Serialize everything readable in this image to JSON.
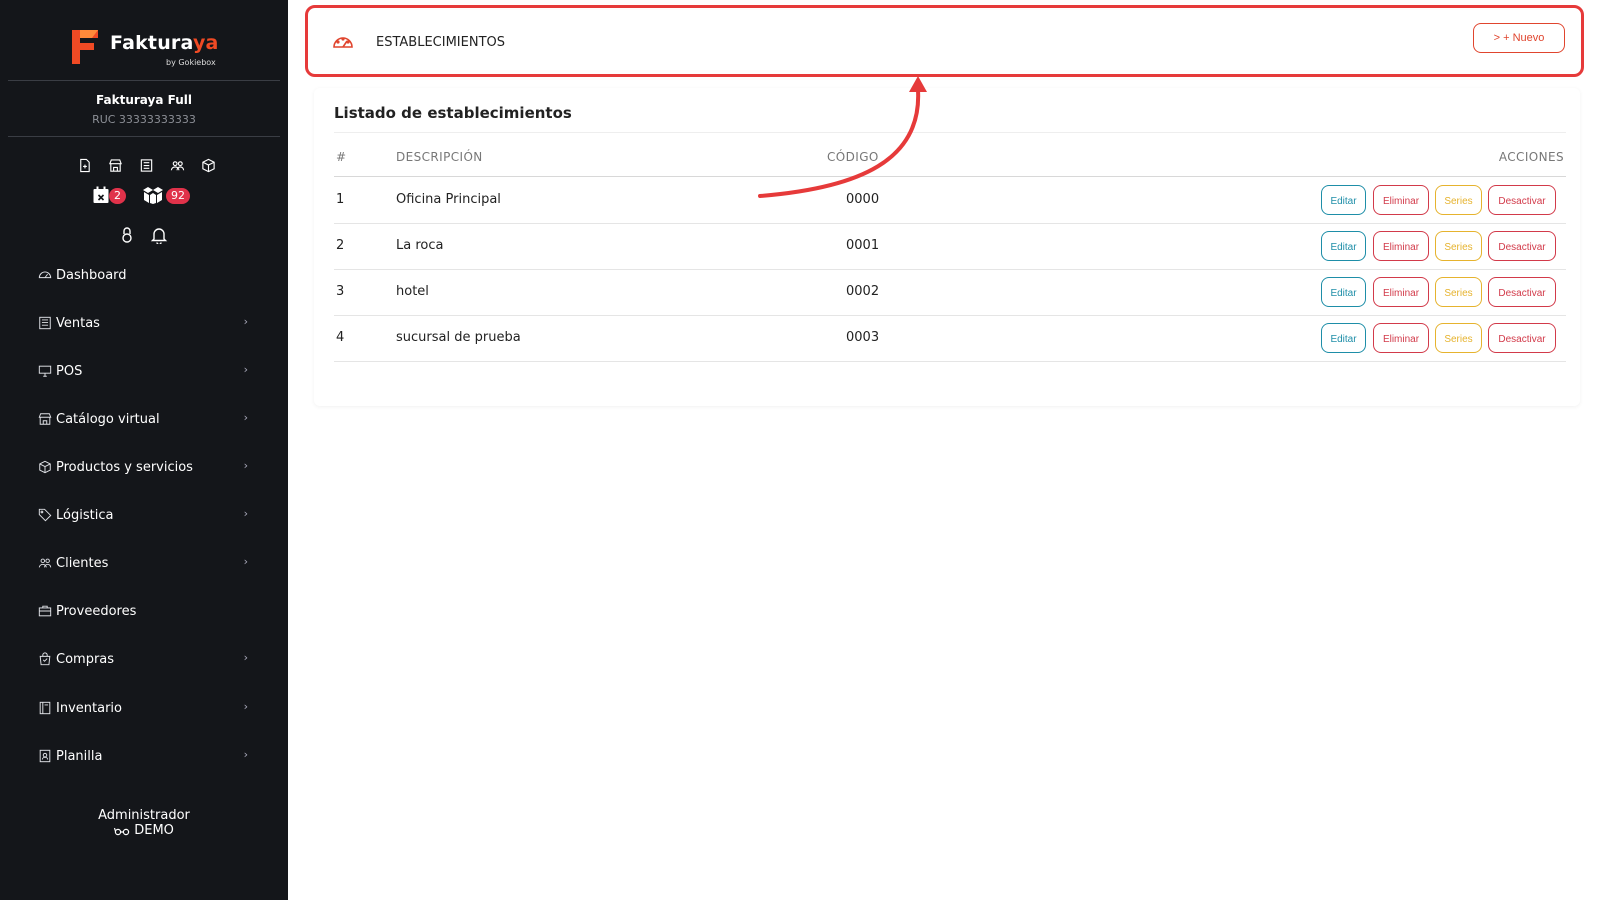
{
  "brand": {
    "name_main": "Faktura",
    "name_accent": "ya",
    "byline": "by Gokiebox",
    "accent_color": "#f04a24",
    "sidebar_bg": "#14161a"
  },
  "company": {
    "name": "Fakturaya Full",
    "ruc": "RUC 33333333333"
  },
  "quick_icons": [
    "document-plus-icon",
    "store-icon",
    "receipt-icon",
    "users-icon",
    "box-icon"
  ],
  "badges": {
    "calendar_count": "2",
    "boxes_count": "92"
  },
  "nav": [
    {
      "label": "Dashboard",
      "icon": "dashboard-icon",
      "has_children": false
    },
    {
      "label": "Ventas",
      "icon": "sales-icon",
      "has_children": true
    },
    {
      "label": "POS",
      "icon": "monitor-icon",
      "has_children": true
    },
    {
      "label": "Catálogo virtual",
      "icon": "store-icon",
      "has_children": true
    },
    {
      "label": "Productos y servicios",
      "icon": "box-icon",
      "has_children": true
    },
    {
      "label": "Lógistica",
      "icon": "tag-icon",
      "has_children": true
    },
    {
      "label": "Clientes",
      "icon": "users-icon",
      "has_children": true
    },
    {
      "label": "Proveedores",
      "icon": "briefcase-icon",
      "has_children": false
    },
    {
      "label": "Compras",
      "icon": "shopping-bag-icon",
      "has_children": true
    },
    {
      "label": "Inventario",
      "icon": "book-icon",
      "has_children": true
    },
    {
      "label": "Planilla",
      "icon": "id-badge-icon",
      "has_children": true
    }
  ],
  "user": {
    "role": "Administrador",
    "name": "DEMO"
  },
  "header": {
    "title": "ESTABLECIMIENTOS",
    "new_button": "> + Nuevo",
    "highlight_color": "#e63a3a"
  },
  "list": {
    "title": "Listado de establecimientos",
    "columns": [
      "#",
      "DESCRIPCIÓN",
      "CÓDIGO",
      "ACCIONES"
    ],
    "rows": [
      {
        "num": "1",
        "description": "Oficina Principal",
        "code": "0000"
      },
      {
        "num": "2",
        "description": "La roca",
        "code": "0001"
      },
      {
        "num": "3",
        "description": "hotel",
        "code": "0002"
      },
      {
        "num": "4",
        "description": "sucursal de prueba",
        "code": "0003"
      }
    ],
    "actions": {
      "edit": "Editar",
      "delete": "Eliminar",
      "series": "Series",
      "deactivate": "Desactivar"
    }
  }
}
